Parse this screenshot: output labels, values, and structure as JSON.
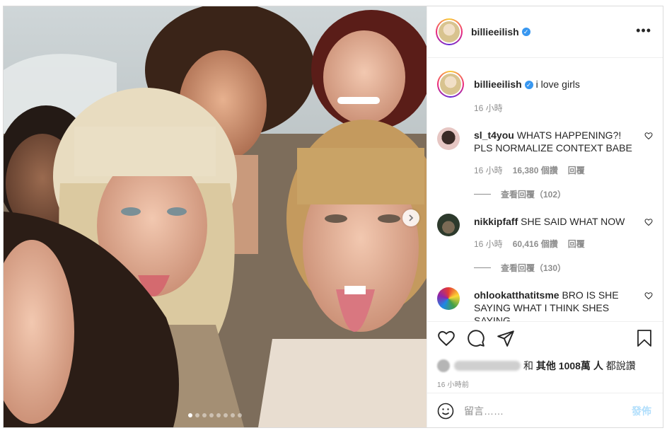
{
  "post": {
    "username": "billieeilish",
    "caption": "i love girls",
    "caption_time": "16 小時",
    "more_icon": "more-options-icon",
    "carousel": {
      "total": 8,
      "active": 1
    }
  },
  "comments": [
    {
      "user": "sl_t4you",
      "text": "WHATS HAPPENING?! PLS NORMALIZE CONTEXT BABE",
      "time": "16 小時",
      "likes": "16,380 個讚",
      "reply": "回覆",
      "view_replies": "查看回覆（102）"
    },
    {
      "user": "nikkipfaff",
      "text": "SHE SAID WHAT NOW",
      "time": "16 小時",
      "likes": "60,416 個讚",
      "reply": "回覆",
      "view_replies": "查看回覆（130）"
    },
    {
      "user": "ohlookatthatitsme",
      "text": "BRO IS SHE SAYING WHAT I THINK SHES SAYING"
    }
  ],
  "likes": {
    "prefix": "和",
    "others": "其他 1008萬 人",
    "suffix": "都說讚"
  },
  "timestamp": "16 小時前",
  "comment_box": {
    "placeholder": "留言……",
    "post_label": "發佈"
  },
  "colors": {
    "verified": "#3897f0",
    "post_disabled": "#b2dffc",
    "muted": "#8e8e8e"
  }
}
